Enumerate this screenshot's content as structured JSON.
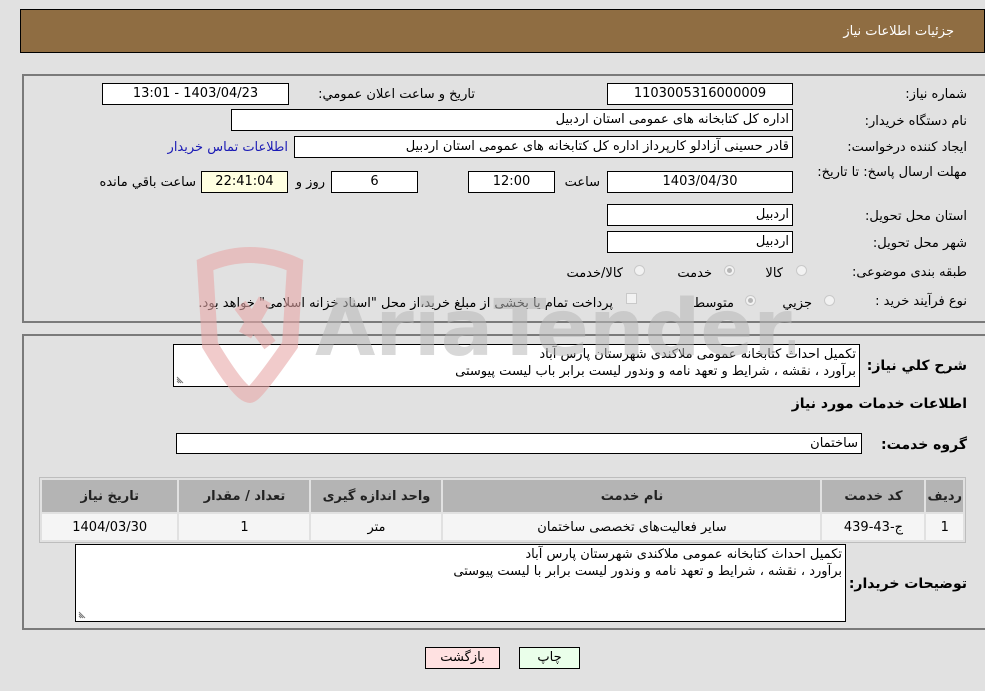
{
  "header": {
    "title": "جزئیات اطلاعات نیاز"
  },
  "fields": {
    "need_number_label": "شماره نیاز:",
    "need_number": "1103005316000009",
    "announce_label": "تاریخ و ساعت اعلان عمومي:",
    "announce_value": "1403/04/23 - 13:01",
    "buyer_org_label": "نام دستگاه خریدار:",
    "buyer_org": "اداره کل کتابخانه های عمومی استان اردبیل",
    "creator_label": "ایجاد کننده درخواست:",
    "creator": "قادر حسینی آزادلو کارپرداز اداره کل کتابخانه های عمومی استان اردبیل",
    "contact_link": "اطلاعات تماس خریدار",
    "deadline_label": "مهلت ارسال پاسخ: تا تاریخ:",
    "deadline_date": "1403/04/30",
    "time_label": "ساعت",
    "deadline_time": "12:00",
    "days_value": "6",
    "days_label": "روز و",
    "remaining_time": "22:41:04",
    "remaining_label": "ساعت باقي مانده",
    "province_label": "استان محل تحویل:",
    "province": "اردبیل",
    "city_label": "شهر محل تحویل:",
    "city": "اردبیل",
    "category_label": "طبقه بندی موضوعی:",
    "category_options": [
      {
        "label": "کالا",
        "checked": false
      },
      {
        "label": "خدمت",
        "checked": true
      },
      {
        "label": "کالا/خدمت",
        "checked": false
      }
    ],
    "process_label": "نوع فرآیند خرید :",
    "process_options": [
      {
        "label": "جزيي",
        "checked": false
      },
      {
        "label": "متوسط",
        "checked": true
      }
    ],
    "payment_note": "پرداخت تمام یا بخشی از مبلغ خرید،از محل \"اسناد خزانه اسلامی\" خواهد بود."
  },
  "summary": {
    "label": "شرح کلي نیاز:",
    "lines": [
      "تکمیل احداث کتابخانه عمومی ملاکندی شهرستان پارس آباد",
      "برآورد ، نقشه ، شرایط و تعهد نامه و وندور لیست برابر باب لیست پیوستی"
    ]
  },
  "services": {
    "section_title": "اطلاعات خدمات مورد نیاز",
    "group_label": "گروه خدمت:",
    "group_value": "ساختمان",
    "columns": [
      "ردیف",
      "کد خدمت",
      "نام خدمت",
      "واحد اندازه گیری",
      "تعداد / مقدار",
      "تاریخ نیاز"
    ],
    "rows": [
      [
        "1",
        "ج-43-439",
        "سایر فعالیت‌های تخصصی ساختمان",
        "متر",
        "1",
        "1404/03/30"
      ]
    ]
  },
  "buyer_notes": {
    "label": "توضیحات خریدار:",
    "lines": [
      "تکمیل احداث کتابخانه عمومی ملاکندی شهرستان پارس آباد",
      "برآورد ، نقشه ، شرایط و تعهد نامه و وندور لیست برابر با لیست پیوستی"
    ]
  },
  "buttons": {
    "print": "چاپ",
    "back": "بازگشت"
  },
  "watermark": "AriaTender.neT",
  "colors": {
    "header_bg": "#8f6d42",
    "print_bg": "#eaffea",
    "back_bg": "#ffe1e1",
    "link": "#1b1bb5"
  }
}
